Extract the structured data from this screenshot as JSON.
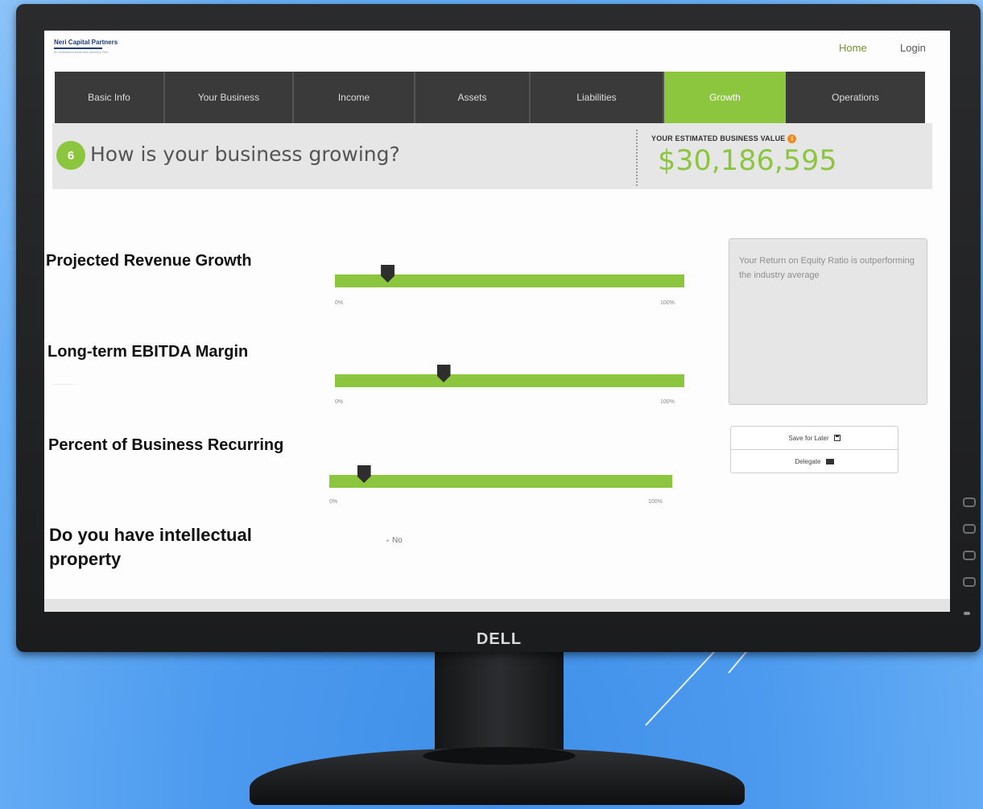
{
  "colors": {
    "accent": "#8cc63f",
    "track": "#8cc63f",
    "value": "#8cc63f",
    "info": "#f08a24",
    "home": "#6a9a2e"
  },
  "brand": {
    "monitor": "DELL",
    "company": "Neri Capital Partners",
    "tagline": "An Investment Bank and Advisory Firm"
  },
  "header": {
    "home": "Home",
    "login": "Login"
  },
  "tabs": [
    {
      "label": "Basic Info",
      "active": false
    },
    {
      "label": "Your Business",
      "active": false
    },
    {
      "label": "Income",
      "active": false
    },
    {
      "label": "Assets",
      "active": false
    },
    {
      "label": "Liabilities",
      "active": false
    },
    {
      "label": "Growth",
      "active": true
    },
    {
      "label": "Operations",
      "active": false
    }
  ],
  "step": {
    "number": "6",
    "question": "How is your business growing?"
  },
  "valuation": {
    "label": "YOUR ESTIMATED BUSINESS VALUE",
    "info_icon": "info-icon",
    "amount": "$30,186,595"
  },
  "questions": {
    "revenue": {
      "label": "Projected Revenue Growth",
      "min": "0%",
      "max": "100%",
      "value_fraction": 0.15
    },
    "ebitda": {
      "label": "Long-term EBITDA Margin",
      "min": "0%",
      "max": "100%",
      "value_fraction": 0.31
    },
    "recurring": {
      "label": "Percent of Business Recurring",
      "min": "0%",
      "max": "100%",
      "value_fraction": 0.1
    },
    "ip": {
      "label": "Do you have intellectual property",
      "option": "No"
    }
  },
  "note": {
    "text": "Your Return on Equity Ratio is outperforming the industry average"
  },
  "actions": {
    "save": "Save for Later",
    "save_icon": "floppy-disk-icon",
    "delegate": "Delegate",
    "delegate_icon": "envelope-icon"
  }
}
